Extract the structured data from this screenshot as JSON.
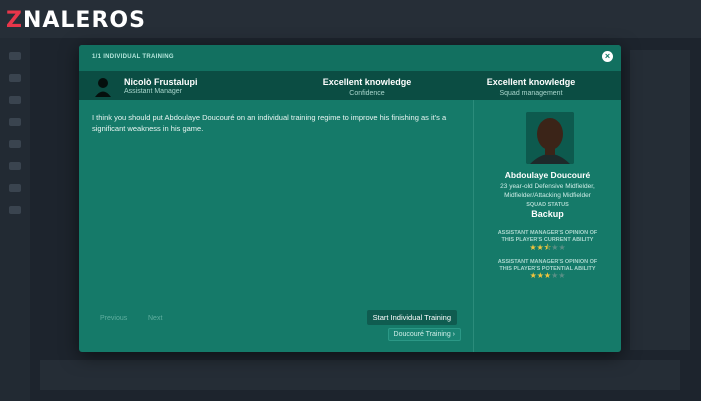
{
  "watermark": {
    "prefix": "Z",
    "rest": "NALEROS"
  },
  "modal": {
    "title": "1/1 INDIVIDUAL TRAINING",
    "close_icon": "close-icon"
  },
  "info_bar": {
    "name": "Nicolò Frustalupi",
    "role": "Assistant Manager",
    "stats": [
      {
        "value": "Excellent knowledge",
        "label": "Confidence"
      },
      {
        "value": "Excellent knowledge",
        "label": "Squad management"
      }
    ]
  },
  "message": "I think you should put Abdoulaye Doucouré on an individual training regime to improve his finishing as it's a significant weakness in his game.",
  "nav": {
    "previous": "Previous",
    "next": "Next"
  },
  "actions": {
    "start": "Start Individual Training",
    "secondary": "Doucouré Training ›"
  },
  "player": {
    "name": "Abdoulaye Doucouré",
    "desc_line1": "23 year-old Defensive Midfielder,",
    "desc_line2": "Midfielder/Attacking Midfielder",
    "squad_status_label": "SQUAD STATUS",
    "squad_status": "Backup",
    "current_ability_label_1": "ASSISTANT MANAGER'S OPINION OF",
    "current_ability_label_2": "THIS PLAYER'S CURRENT ABILITY",
    "current_ability_stars": 2.5,
    "potential_ability_label_1": "ASSISTANT MANAGER'S OPINION OF",
    "potential_ability_label_2": "THIS PLAYER'S POTENTIAL ABILITY",
    "potential_ability_stars": 3
  },
  "colors": {
    "modal": "#157a69",
    "info_bar": "#0b4d43",
    "star": "#f2c53d"
  }
}
